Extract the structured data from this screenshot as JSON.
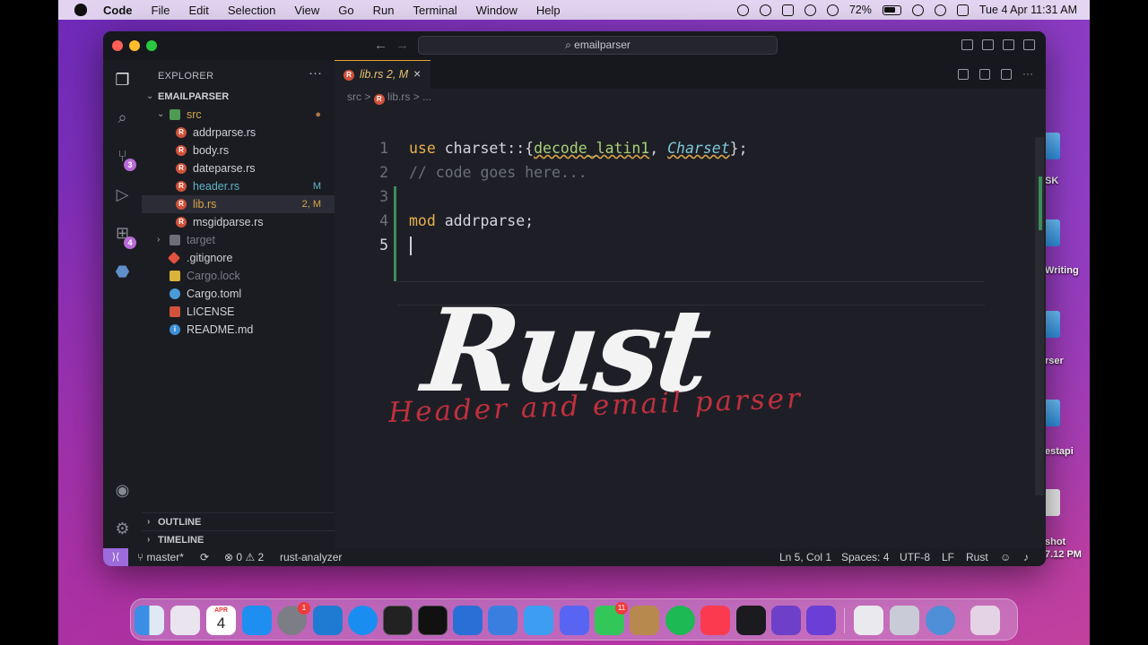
{
  "menubar": {
    "app": "Code",
    "items": [
      "File",
      "Edit",
      "Selection",
      "View",
      "Go",
      "Run",
      "Terminal",
      "Window",
      "Help"
    ],
    "battery": "72%",
    "datetime": "Tue 4 Apr  11:31 AM"
  },
  "desktop": {
    "labels": [
      "SK",
      "Writing",
      "rser",
      "estapi",
      "shot",
      "7.12 PM"
    ]
  },
  "window": {
    "command_center": "emailparser"
  },
  "explorer": {
    "title": "EXPLORER",
    "more": "···",
    "root": "EMAILPARSER",
    "items": [
      {
        "name": "src",
        "decoration": "",
        "color": "#d7a74a"
      },
      {
        "name": "addrparse.rs",
        "decoration": "",
        "color": "#cfd0d6"
      },
      {
        "name": "body.rs",
        "decoration": "",
        "color": "#cfd0d6"
      },
      {
        "name": "dateparse.rs",
        "decoration": "",
        "color": "#cfd0d6"
      },
      {
        "name": "header.rs",
        "decoration": "M",
        "color": "#5fb4c4"
      },
      {
        "name": "lib.rs",
        "decoration": "2, M",
        "color": "#d7a74a"
      },
      {
        "name": "msgidparse.rs",
        "decoration": "",
        "color": "#cfd0d6"
      },
      {
        "name": "target",
        "decoration": "",
        "color": "#7a7c86"
      },
      {
        "name": ".gitignore",
        "decoration": "",
        "color": "#cfd0d6"
      },
      {
        "name": "Cargo.lock",
        "decoration": "",
        "color": "#7a7c86"
      },
      {
        "name": "Cargo.toml",
        "decoration": "",
        "color": "#cfd0d6"
      },
      {
        "name": "LICENSE",
        "decoration": "",
        "color": "#cfd0d6"
      },
      {
        "name": "README.md",
        "decoration": "",
        "color": "#cfd0d6"
      }
    ],
    "outline": "OUTLINE",
    "timeline": "TIMELINE"
  },
  "activity_badges": {
    "scm": "3",
    "extensions": "4"
  },
  "editor": {
    "tab": {
      "name": "lib.rs",
      "decoration": "2, M",
      "close": "×"
    },
    "breadcrumb": {
      "folder": "src",
      "sep": ">",
      "file": "lib.rs",
      "tail": "> ..."
    },
    "line_numbers": [
      "1",
      "2",
      "3",
      "4",
      "5"
    ],
    "line1": {
      "kw": "use",
      "path": " charset::{",
      "fn": "decode_latin1",
      "comma": ", ",
      "ty": "Charset",
      "end": "};"
    },
    "line2": {
      "comment": "// code goes here..."
    },
    "line4": {
      "kw": "mod",
      "rest": " addrparse;"
    }
  },
  "watermark": {
    "title": "Rust",
    "subtitle": "Header and email parser"
  },
  "statusbar": {
    "branch": "master*",
    "problems": "⊗ 0 ⚠ 2",
    "analyzer": "rust-analyzer",
    "position": "Ln 5, Col 1",
    "spaces": "Spaces: 4",
    "encoding": "UTF-8",
    "eol": "LF",
    "language": "Rust"
  },
  "dock": {
    "calendar_month": "APR",
    "calendar_day": "4",
    "badges": [
      "1",
      "11"
    ]
  }
}
